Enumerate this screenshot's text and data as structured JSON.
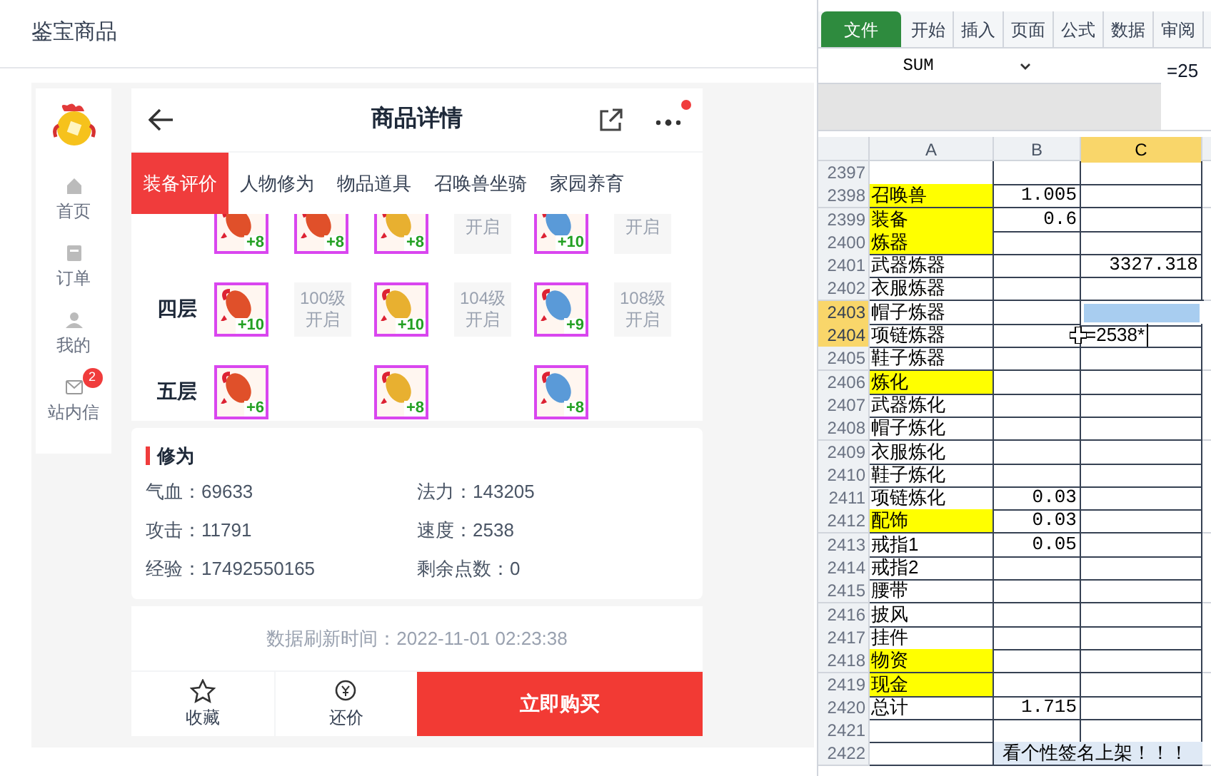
{
  "page_title": "鉴宝商品",
  "sidebar": {
    "items": [
      {
        "kind": "home",
        "label": "首页"
      },
      {
        "kind": "order",
        "label": "订单"
      },
      {
        "kind": "user",
        "label": "我的"
      },
      {
        "kind": "mail",
        "label": "站内信",
        "badge": "2"
      }
    ]
  },
  "detail": {
    "title": "商品详情",
    "has_notice": true,
    "tabs": [
      {
        "label": "装备评价",
        "selected": true
      },
      {
        "label": "人物修为",
        "selected": false
      },
      {
        "label": "物品道具",
        "selected": false
      },
      {
        "label": "召唤兽坐骑",
        "selected": false
      },
      {
        "label": "家园养育",
        "selected": false
      }
    ],
    "equipment_rows": [
      {
        "cells": [
          {
            "kind": "item",
            "badge": "+8",
            "color": "#e0502a"
          },
          {
            "kind": "item",
            "badge": "+8",
            "color": "#e0502a"
          },
          {
            "kind": "item",
            "badge": "+8",
            "color": "#e8b030"
          },
          {
            "kind": "lock",
            "text": "开启"
          },
          {
            "kind": "item",
            "badge": "+10",
            "color": "#5a9ad8"
          },
          {
            "kind": "lock",
            "text": "开启"
          }
        ]
      },
      {
        "layer": "四层",
        "cells": [
          {
            "kind": "item",
            "badge": "+10",
            "color": "#e0502a"
          },
          {
            "kind": "lock",
            "text": "100级开启"
          },
          {
            "kind": "item",
            "badge": "+10",
            "color": "#e8b030"
          },
          {
            "kind": "lock",
            "text": "104级开启"
          },
          {
            "kind": "item",
            "badge": "+9",
            "color": "#5a9ad8"
          },
          {
            "kind": "lock",
            "text": "108级开启"
          }
        ]
      },
      {
        "layer": "五层",
        "cells": [
          {
            "kind": "item",
            "badge": "+6",
            "color": "#e0502a"
          },
          {
            "kind": "empty"
          },
          {
            "kind": "item",
            "badge": "+8",
            "color": "#e8b030"
          },
          {
            "kind": "empty"
          },
          {
            "kind": "item",
            "badge": "+8",
            "color": "#5a9ad8"
          },
          {
            "kind": "empty"
          }
        ]
      }
    ],
    "stats": {
      "title": "修为",
      "items": [
        "气血：69633",
        "法力：143205",
        "攻击：11791",
        "速度：2538",
        "经验：17492550165",
        "剩余点数：0"
      ]
    },
    "refresh_time": "数据刷新时间：2022-11-01 02:23:38",
    "actions": [
      {
        "kind": "star",
        "label": "收藏"
      },
      {
        "kind": "bargain",
        "label": "还价"
      }
    ],
    "buy_button": "立即购买"
  },
  "spreadsheet": {
    "ribbon_tabs": [
      {
        "label": "文件",
        "selected": true
      },
      {
        "label": "开始",
        "selected": false
      },
      {
        "label": "插入",
        "selected": false
      },
      {
        "label": "页面",
        "selected": false
      },
      {
        "label": "公式",
        "selected": false
      },
      {
        "label": "数据",
        "selected": false
      },
      {
        "label": "审阅",
        "selected": false
      }
    ],
    "name_box": "SUM",
    "formula": "=25",
    "columns": [
      {
        "label": "A",
        "selected": false
      },
      {
        "label": "B",
        "selected": false
      },
      {
        "label": "C",
        "selected": true
      }
    ],
    "rows": [
      {
        "num": "2397",
        "selected": false
      },
      {
        "num": "2398",
        "selected": false,
        "a": "召唤兽",
        "highlight": true,
        "b": "1.005"
      },
      {
        "num": "2399",
        "selected": false,
        "a": "装备",
        "highlight": true,
        "b": "0.6"
      },
      {
        "num": "2400",
        "selected": false,
        "a": "炼器",
        "highlight": true
      },
      {
        "num": "2401",
        "selected": false,
        "a": "武器炼器",
        "highlight": false,
        "c": "3327.318"
      },
      {
        "num": "2402",
        "selected": false,
        "a": "衣服炼器",
        "highlight": false
      },
      {
        "num": "2403",
        "selected": true,
        "a": "帽子炼器",
        "highlight": false,
        "kind": "selection"
      },
      {
        "num": "2404",
        "selected": true,
        "a": "项链炼器",
        "highlight": false,
        "c": "=2538*",
        "kind": "editing"
      },
      {
        "num": "2405",
        "selected": false,
        "a": "鞋子炼器",
        "highlight": false
      },
      {
        "num": "2406",
        "selected": false,
        "a": "炼化",
        "highlight": true
      },
      {
        "num": "2407",
        "selected": false,
        "a": "武器炼化",
        "highlight": false
      },
      {
        "num": "2408",
        "selected": false,
        "a": "帽子炼化",
        "highlight": false
      },
      {
        "num": "2409",
        "selected": false,
        "a": "衣服炼化",
        "highlight": false
      },
      {
        "num": "2410",
        "selected": false,
        "a": "鞋子炼化",
        "highlight": false
      },
      {
        "num": "2411",
        "selected": false,
        "a": "项链炼化",
        "highlight": false,
        "b": "0.03"
      },
      {
        "num": "2412",
        "selected": false,
        "a": "配饰",
        "highlight": true,
        "b": "0.03"
      },
      {
        "num": "2413",
        "selected": false,
        "a": "戒指1",
        "highlight": false,
        "b": "0.05"
      },
      {
        "num": "2414",
        "selected": false,
        "a": "戒指2",
        "highlight": false
      },
      {
        "num": "2415",
        "selected": false,
        "a": "腰带",
        "highlight": false
      },
      {
        "num": "2416",
        "selected": false,
        "a": "披风",
        "highlight": false
      },
      {
        "num": "2417",
        "selected": false,
        "a": "挂件",
        "highlight": false
      },
      {
        "num": "2418",
        "selected": false,
        "a": "物资",
        "highlight": true
      },
      {
        "num": "2419",
        "selected": false,
        "a": "现金",
        "highlight": true
      },
      {
        "num": "2420",
        "selected": false,
        "a": "总计",
        "highlight": false,
        "b": "1.715"
      },
      {
        "num": "2421",
        "selected": false
      },
      {
        "num": "2422",
        "selected": false,
        "kind": "banner",
        "banner": "看个性签名上架！！！"
      }
    ]
  }
}
